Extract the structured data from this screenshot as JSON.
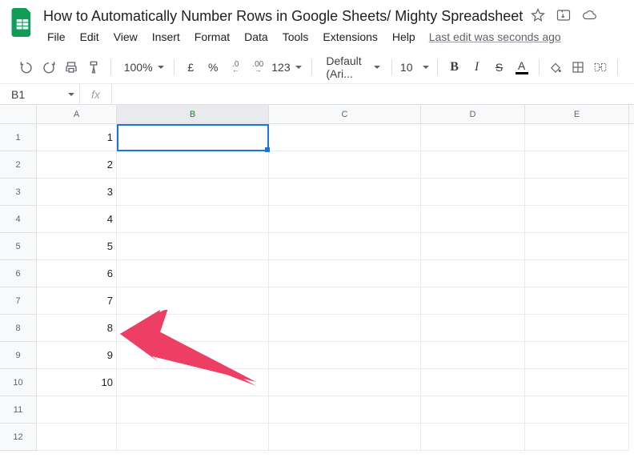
{
  "doc": {
    "title": "How to Automatically Number Rows in Google Sheets/ Mighty Spreadsheet",
    "last_edit": "Last edit was seconds ago"
  },
  "menus": [
    "File",
    "Edit",
    "View",
    "Insert",
    "Format",
    "Data",
    "Tools",
    "Extensions",
    "Help"
  ],
  "toolbar": {
    "zoom": "100%",
    "currency": "£",
    "percent": "%",
    "dec_dec": ".0",
    "inc_dec": ".00",
    "more_formats": "123",
    "font": "Default (Ari...",
    "font_size": "10"
  },
  "namebox": "B1",
  "fx_label": "fx",
  "formula": "",
  "columns": [
    "A",
    "B",
    "C",
    "D",
    "E"
  ],
  "selected_column_index": 1,
  "rows": [
    {
      "n": "1",
      "a": "1"
    },
    {
      "n": "2",
      "a": "2"
    },
    {
      "n": "3",
      "a": "3"
    },
    {
      "n": "4",
      "a": "4"
    },
    {
      "n": "5",
      "a": "5"
    },
    {
      "n": "6",
      "a": "6"
    },
    {
      "n": "7",
      "a": "7"
    },
    {
      "n": "8",
      "a": "8"
    },
    {
      "n": "9",
      "a": "9"
    },
    {
      "n": "10",
      "a": "10"
    },
    {
      "n": "11",
      "a": ""
    },
    {
      "n": "12",
      "a": ""
    }
  ],
  "arrow_color": "#ef3e63"
}
